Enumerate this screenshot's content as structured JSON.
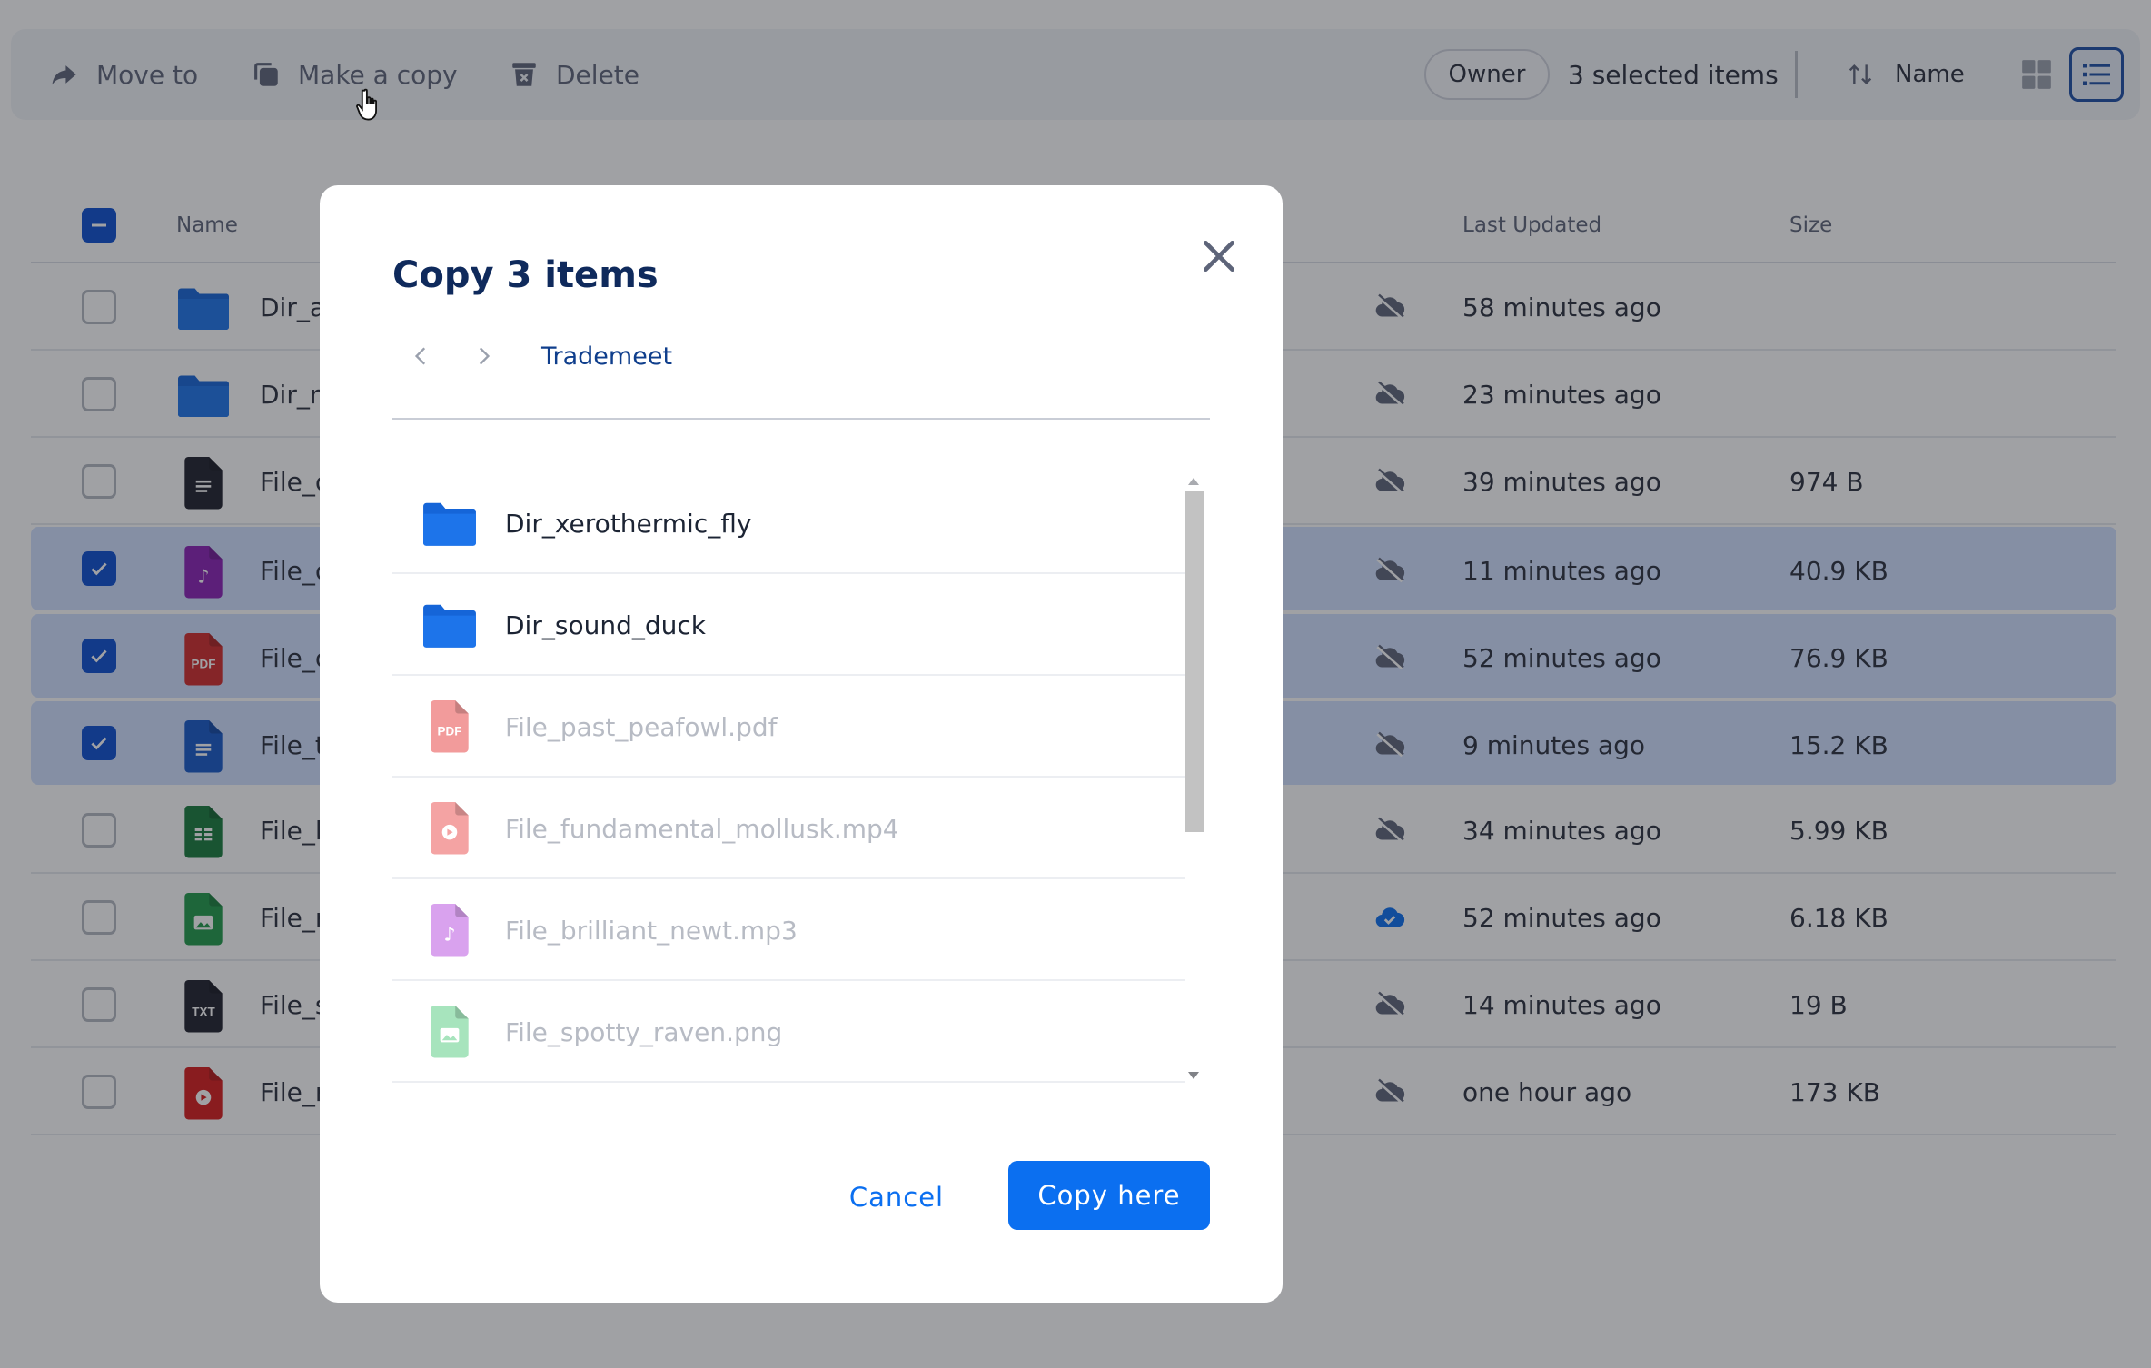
{
  "toolbar": {
    "move_label": "Move to",
    "copy_label": "Make a copy",
    "delete_label": "Delete",
    "owner_label": "Owner",
    "selected_text": "3 selected items",
    "sort_label": "Name",
    "icons": [
      "arrow-right-icon",
      "copy-icon",
      "trash-icon",
      "sort-icon",
      "grid-view-icon",
      "list-view-icon"
    ]
  },
  "table": {
    "col_name": "Name",
    "col_updated": "Last Updated",
    "col_size": "Size",
    "rows": [
      {
        "name": "Dir_a",
        "type": "folder",
        "selected": false,
        "synced": false,
        "updated": "58 minutes ago",
        "size": ""
      },
      {
        "name": "Dir_n",
        "type": "folder",
        "selected": false,
        "synced": false,
        "updated": "23 minutes ago",
        "size": ""
      },
      {
        "name": "File_c",
        "type": "doc-dark",
        "selected": false,
        "synced": false,
        "updated": "39 minutes ago",
        "size": "974 B"
      },
      {
        "name": "File_c",
        "type": "audio",
        "selected": true,
        "synced": false,
        "updated": "11 minutes ago",
        "size": "40.9 KB"
      },
      {
        "name": "File_c",
        "type": "pdf",
        "selected": true,
        "synced": false,
        "updated": "52 minutes ago",
        "size": "76.9 KB"
      },
      {
        "name": "File_t",
        "type": "doc-blue",
        "selected": true,
        "synced": false,
        "updated": "9 minutes ago",
        "size": "15.2 KB"
      },
      {
        "name": "File_l",
        "type": "sheet",
        "selected": false,
        "synced": false,
        "updated": "34 minutes ago",
        "size": "5.99 KB"
      },
      {
        "name": "File_r",
        "type": "image",
        "selected": false,
        "synced": true,
        "updated": "52 minutes ago",
        "size": "6.18 KB"
      },
      {
        "name": "File_s",
        "type": "txt",
        "selected": false,
        "synced": false,
        "updated": "14 minutes ago",
        "size": "19 B"
      },
      {
        "name": "File_r",
        "type": "video",
        "selected": false,
        "synced": false,
        "updated": "one hour ago",
        "size": "173 KB"
      }
    ]
  },
  "dialog": {
    "title": "Copy 3 items",
    "breadcrumb": "Trademeet",
    "items": [
      {
        "name": "Dir_xerothermic_fly",
        "type": "folder",
        "disabled": false
      },
      {
        "name": "Dir_sound_duck",
        "type": "folder",
        "disabled": false
      },
      {
        "name": "File_past_peafowl.pdf",
        "type": "pdf",
        "disabled": true
      },
      {
        "name": "File_fundamental_mollusk.mp4",
        "type": "video",
        "disabled": true
      },
      {
        "name": "File_brilliant_newt.mp3",
        "type": "audio",
        "disabled": true
      },
      {
        "name": "File_spotty_raven.png",
        "type": "image",
        "disabled": true
      }
    ],
    "cancel_label": "Cancel",
    "confirm_label": "Copy here"
  },
  "colors": {
    "accent": "#0b6ff0",
    "selected_row": "#d0e0ff",
    "checkbox_on": "#0b4fd0",
    "folder": "#1565d8",
    "title": "#0f2a5c"
  }
}
